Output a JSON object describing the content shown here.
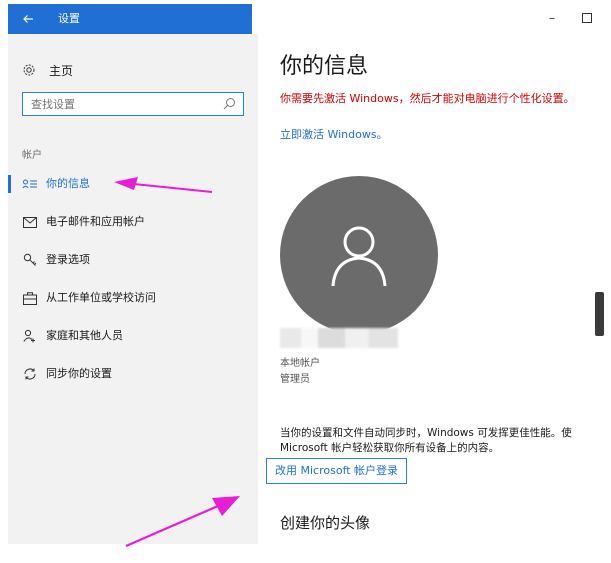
{
  "window": {
    "title": "设置",
    "back_icon": "arrow-left-icon",
    "minimize_glyph": "–"
  },
  "sidebar": {
    "home_label": "主页",
    "search_placeholder": "查找设置",
    "section_label": "帐户",
    "items": [
      {
        "label": "你的信息",
        "icon": "person-card-icon",
        "active": true
      },
      {
        "label": "电子邮件和应用帐户",
        "icon": "mail-icon",
        "active": false
      },
      {
        "label": "登录选项",
        "icon": "key-icon",
        "active": false
      },
      {
        "label": "从工作单位或学校访问",
        "icon": "briefcase-icon",
        "active": false
      },
      {
        "label": "家庭和其他人员",
        "icon": "person-add-icon",
        "active": false
      },
      {
        "label": "同步你的设置",
        "icon": "sync-icon",
        "active": false
      }
    ]
  },
  "main": {
    "title": "你的信息",
    "warning": "你需要先激活 Windows，然后才能对电脑进行个性化设置。",
    "activate_link": "立即激活 Windows。",
    "account_type": "本地帐户",
    "account_role": "管理员",
    "sync_text_line1": "当你的设置和文件自动同步时，Windows 可发挥更佳性能。使",
    "sync_text_line2": "Microsoft 帐户轻松获取你所有设备上的内容。",
    "ms_link": "改用 Microsoft 帐户登录",
    "section_title": "创建你的头像"
  },
  "colors": {
    "accent": "#1f6fd4",
    "warning": "#d40000",
    "annotation_arrow": "#e81ed6",
    "avatar_bg": "#6b6b6b"
  }
}
